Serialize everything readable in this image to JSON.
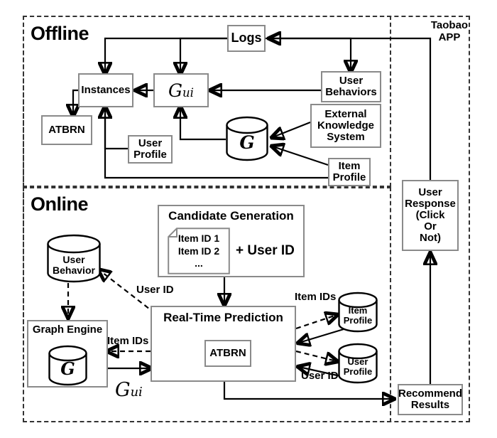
{
  "figure": {
    "type": "system-architecture-diagram",
    "title": "ATBRN recommendation system architecture (offline / online)"
  },
  "sections": {
    "offline": {
      "label": "Offline"
    },
    "online": {
      "label": "Online"
    },
    "taobao": {
      "label": "Taobao\nAPP",
      "line1": "Taobao",
      "line2": "APP"
    }
  },
  "offline": {
    "logs": {
      "label": "Logs"
    },
    "instances": {
      "label": "Instances"
    },
    "gui": {
      "label": "Gui",
      "base": "G",
      "sub": "ui"
    },
    "atbrn": {
      "label": "ATBRN"
    },
    "user_behaviors": {
      "line1": "User",
      "line2": "Behaviors"
    },
    "external_knowledge": {
      "line1": "External",
      "line2": "Knowledge",
      "line3": "System"
    },
    "user_profile": {
      "line1": "User",
      "line2": "Profile"
    },
    "item_profile": {
      "line1": "Item",
      "line2": "Profile"
    },
    "graph_db": {
      "label": "G"
    }
  },
  "online": {
    "user_behavior_db": {
      "line1": "User",
      "line2": "Behavior"
    },
    "graph_engine": {
      "label": "Graph Engine",
      "db_label": "G"
    },
    "gui_label": {
      "base": "G",
      "sub": "ui"
    },
    "candidate_generation": {
      "title": "Candidate Generation",
      "doc_lines": [
        "Item ID 1",
        "Item ID 2",
        "..."
      ],
      "plus_user_id": "+ User ID"
    },
    "real_time_prediction": {
      "title": "Real-Time Prediction",
      "inner": "ATBRN"
    },
    "item_profile_db": {
      "line1": "Item",
      "line2": "Profile"
    },
    "user_profile_db": {
      "line1": "User",
      "line2": "Profile"
    },
    "recommend_results": {
      "line1": "Recommend",
      "line2": "Results"
    }
  },
  "right_column": {
    "user_response": {
      "line1": "User",
      "line2": "Response",
      "line3": "(Click",
      "line4": "Or",
      "line5": "Not)"
    }
  },
  "edge_labels": {
    "user_id_top": "User ID",
    "item_ids_left": "Item IDs",
    "item_ids_right": "Item IDs",
    "user_id_right": "User ID"
  },
  "colors": {
    "stroke": "#000000",
    "node_border": "#8a8a8a",
    "dashed_border": "#333333",
    "background": "#ffffff",
    "text": "#000000"
  }
}
